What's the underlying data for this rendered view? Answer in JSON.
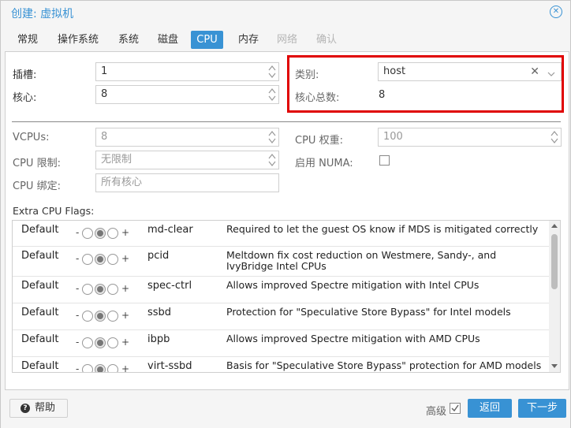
{
  "dialog": {
    "title": "创建: 虚拟机"
  },
  "tabs": [
    {
      "label": "常规",
      "state": "normal"
    },
    {
      "label": "操作系统",
      "state": "normal"
    },
    {
      "label": "系统",
      "state": "normal"
    },
    {
      "label": "磁盘",
      "state": "normal"
    },
    {
      "label": "CPU",
      "state": "active"
    },
    {
      "label": "内存",
      "state": "normal"
    },
    {
      "label": "网络",
      "state": "disabled"
    },
    {
      "label": "确认",
      "state": "disabled"
    }
  ],
  "cpu": {
    "sockets_label": "插槽:",
    "sockets_value": "1",
    "cores_label": "核心:",
    "cores_value": "8",
    "type_label": "类别:",
    "type_value": "host",
    "total_cores_label": "核心总数:",
    "total_cores_value": "8",
    "vcpus_label": "VCPUs:",
    "vcpus_value": "8",
    "cpu_limit_label": "CPU 限制:",
    "cpu_limit_value": "无限制",
    "cpu_affinity_label": "CPU 绑定:",
    "cpu_affinity_placeholder": "所有核心",
    "cpu_weight_label": "CPU 权重:",
    "cpu_weight_value": "100",
    "numa_label": "启用 NUMA:",
    "numa_checked": false
  },
  "flags": {
    "title": "Extra CPU Flags:",
    "minus": "-",
    "plus": "+",
    "rows": [
      {
        "state": "Default",
        "name": "md-clear",
        "desc": "Required to let the guest OS know if MDS is mitigated correctly"
      },
      {
        "state": "Default",
        "name": "pcid",
        "desc": "Meltdown fix cost reduction on Westmere, Sandy-, and IvyBridge Intel CPUs"
      },
      {
        "state": "Default",
        "name": "spec-ctrl",
        "desc": "Allows improved Spectre mitigation with Intel CPUs"
      },
      {
        "state": "Default",
        "name": "ssbd",
        "desc": "Protection for \"Speculative Store Bypass\" for Intel models"
      },
      {
        "state": "Default",
        "name": "ibpb",
        "desc": "Allows improved Spectre mitigation with AMD CPUs"
      },
      {
        "state": "Default",
        "name": "virt-ssbd",
        "desc": "Basis for \"Speculative Store Bypass\" protection for AMD models"
      }
    ]
  },
  "footer": {
    "help_label": "帮助",
    "advanced_label": "高级",
    "advanced_checked": true,
    "back_label": "返回",
    "next_label": "下一步"
  },
  "colors": {
    "accent": "#3892d4",
    "highlight_border": "#e00000"
  }
}
